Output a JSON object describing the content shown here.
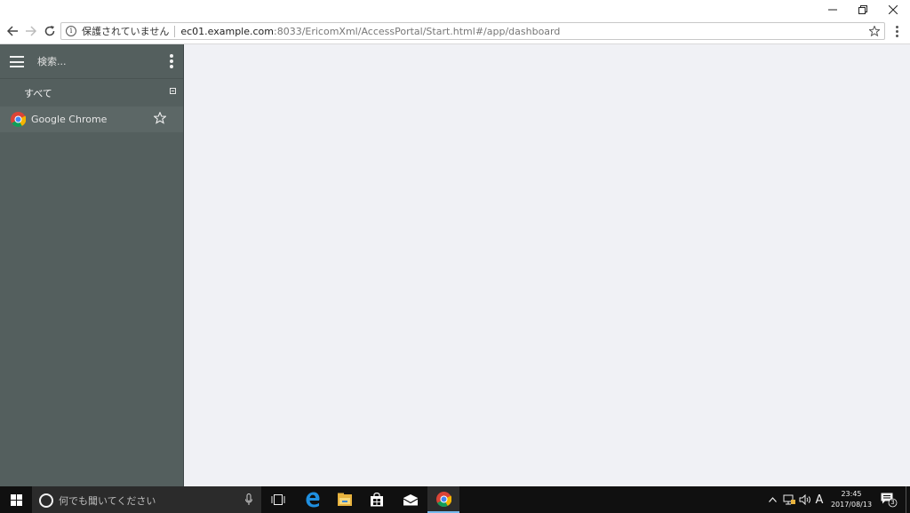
{
  "browser": {
    "security_label": "保護されていません",
    "url_host": "ec01.example.com",
    "url_path": ":8033/EricomXml/AccessPortal/Start.html#/app/dashboard"
  },
  "sidebar": {
    "search_placeholder": "検索...",
    "category_all": "すべて",
    "apps": [
      {
        "label": "Google Chrome",
        "icon": "chrome-icon",
        "favorite": false
      }
    ]
  },
  "taskbar": {
    "search_placeholder": "何でも聞いてください",
    "ime_label": "A",
    "time": "23:45",
    "date": "2017/08/13",
    "notification_count": "3"
  },
  "colors": {
    "sidebar_bg": "#545f5e",
    "main_bg": "#f0f1f5",
    "taskbar_bg": "#101010",
    "chrome_red": "#db4437",
    "chrome_green": "#0f9d58",
    "chrome_yellow": "#f4b400",
    "chrome_blue": "#4285f4"
  }
}
